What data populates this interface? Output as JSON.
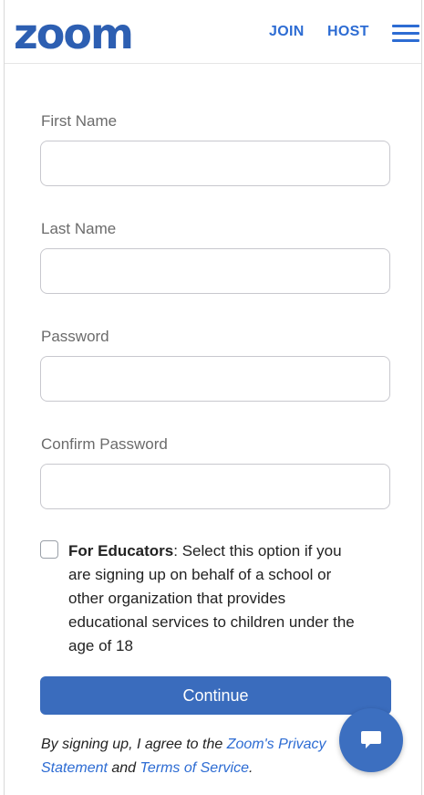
{
  "header": {
    "logo_text": "zoom",
    "join_label": "JOIN",
    "host_label": "HOST",
    "menu_icon": "hamburger-menu-icon"
  },
  "form": {
    "first_name": {
      "label": "First Name",
      "value": "",
      "placeholder": ""
    },
    "last_name": {
      "label": "Last Name",
      "value": "",
      "placeholder": ""
    },
    "password": {
      "label": "Password",
      "value": "",
      "placeholder": ""
    },
    "confirm_password": {
      "label": "Confirm Password",
      "value": "",
      "placeholder": ""
    }
  },
  "educators": {
    "checked": false,
    "title": "For Educators",
    "text": ": Select this option if you are signing up on behalf of a school or other organization that provides educational services to children under the age of 18"
  },
  "continue_label": "Continue",
  "agreement": {
    "prefix": "By signing up, I agree to the ",
    "privacy_link": "Zoom's Privacy Statement",
    "middle": " and ",
    "terms_link": "Terms of Service",
    "suffix": "."
  },
  "chat": {
    "icon": "chat-bubble-icon"
  },
  "colors": {
    "brand": "#2d5fb2",
    "link": "#2d6cd3",
    "button": "#3a6cbd"
  }
}
